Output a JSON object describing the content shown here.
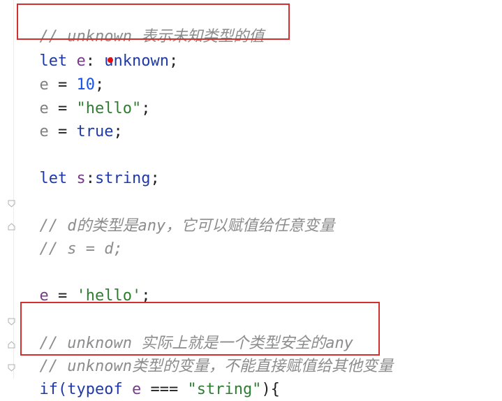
{
  "editor": {
    "lines": [
      {
        "id": "l1",
        "tokens": [
          "// unknown 表示未知类型的值"
        ]
      },
      {
        "id": "l2",
        "tokens": [
          "let",
          " ",
          "e",
          ": ",
          "unknown",
          ";"
        ]
      },
      {
        "id": "l3",
        "tokens": [
          "e",
          " = ",
          "10",
          ";"
        ]
      },
      {
        "id": "l4",
        "tokens": [
          "e",
          " = ",
          "\"hello\"",
          ";"
        ]
      },
      {
        "id": "l5",
        "tokens": [
          "e",
          " = ",
          "true",
          ";"
        ]
      },
      {
        "id": "l6",
        "tokens": [
          "let",
          " ",
          "s",
          ":",
          "string",
          ";"
        ]
      },
      {
        "id": "l7",
        "tokens": [
          "// d的类型是any，它可以赋值给任意变量"
        ]
      },
      {
        "id": "l8",
        "tokens": [
          "// s = d;"
        ]
      },
      {
        "id": "l9",
        "tokens": [
          "e",
          " = ",
          "'hello'",
          ";"
        ]
      },
      {
        "id": "l10",
        "tokens": [
          "// unknown 实际上就是一个类型安全的any"
        ]
      },
      {
        "id": "l11",
        "tokens": [
          "// unknown类型的变量，不能直接赋值给其他变量"
        ]
      },
      {
        "id": "l12",
        "tokens": [
          "if(",
          "typeof",
          " ",
          "e",
          " === ",
          "\"string\"",
          "){"
        ]
      }
    ]
  },
  "colors": {
    "annotation_box": "#d32f2f",
    "breakpoint_dot": "#e01010",
    "comment": "#8c8c8c",
    "keyword": "#1f3aa6",
    "string": "#2e7d32",
    "number": "#1750eb"
  },
  "icons": {
    "fold": "fold-marker-icon",
    "dot": "red-dot-marker"
  }
}
